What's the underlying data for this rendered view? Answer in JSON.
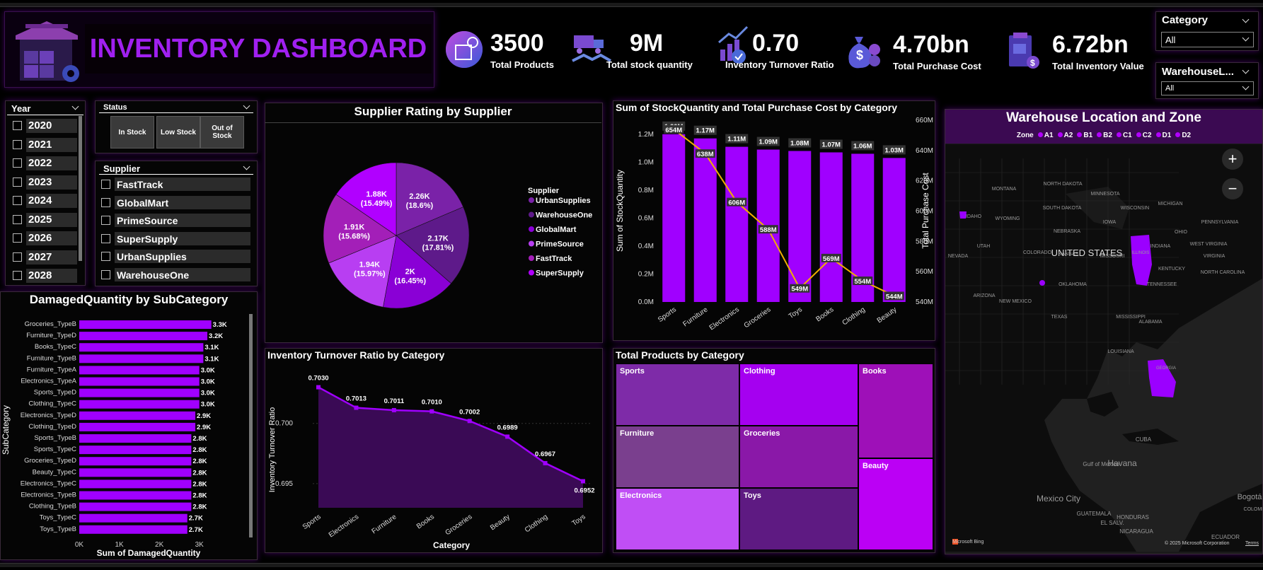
{
  "header": {
    "title": "INVENTORY DASHBOARD",
    "kpis": [
      {
        "value": "3500",
        "label": "Total Products"
      },
      {
        "value": "9M",
        "label": "Total stock quantity"
      },
      {
        "value": "0.70",
        "label": "Inventory Turnover Ratio"
      },
      {
        "value": "4.70bn",
        "label": "Total Purchase Cost"
      },
      {
        "value": "6.72bn",
        "label": "Total Inventory Value"
      }
    ]
  },
  "filters": {
    "category": {
      "label": "Category",
      "value": "All"
    },
    "warehouse": {
      "label": "WarehouseL...",
      "value": "All"
    },
    "year": {
      "label": "Year",
      "items": [
        "2020",
        "2021",
        "2022",
        "2023",
        "2024",
        "2025",
        "2026",
        "2027",
        "2028"
      ]
    },
    "status": {
      "label": "Status",
      "buttons": [
        "In Stock",
        "Low Stock",
        "Out of Stock"
      ]
    },
    "supplier": {
      "label": "Supplier",
      "items": [
        "FastTrack",
        "GlobalMart",
        "PrimeSource",
        "SuperSupply",
        "UrbanSupplies",
        "WarehouseOne"
      ]
    }
  },
  "colors": {
    "accent": "#9b00ff",
    "bar": "#a000ff",
    "line": "#f0b000",
    "panel_border": "#3a2a3a"
  },
  "charts": {
    "damaged": {
      "title": "DamagedQuantity by SubCategory",
      "xlabel": "Sum of DamagedQuantity",
      "ylabel": "SubCategory",
      "ticks": [
        "0K",
        "1K",
        "2K",
        "3K"
      ]
    },
    "pie": {
      "title": "Supplier Rating by Supplier",
      "legend_title": "Supplier"
    },
    "combo": {
      "title": "Sum of StockQuantity and Total Purchase Cost by Category",
      "ylabel_left": "Sum of StockQuantity",
      "ylabel_right": "Total Purchase Cost",
      "left_ticks": [
        "0.0M",
        "0.2M",
        "0.4M",
        "0.6M",
        "0.8M",
        "1.0M",
        "1.2M"
      ],
      "right_ticks": [
        "540M",
        "560M",
        "580M",
        "600M",
        "620M",
        "640M",
        "660M"
      ]
    },
    "turnover": {
      "title": "Inventory Turnover Ratio by Category",
      "xlabel": "Category",
      "ylabel": "Inventory Turnover Ratio",
      "yticks": [
        "0.695",
        "0.700"
      ]
    },
    "treemap": {
      "title": "Total Products by Category"
    },
    "map": {
      "title": "Warehouse Location and Zone",
      "legend_title": "Zone",
      "zones": [
        "A1",
        "A2",
        "B1",
        "B2",
        "C1",
        "C2",
        "D1",
        "D2"
      ],
      "labels": [
        "UNITED STATES",
        "Havana",
        "Mexico City",
        "CUBA",
        "GUATEMALA",
        "NICARAGUA",
        "HONDURAS",
        "EL SALV.",
        "Bogotá",
        "COLOMBIA",
        "ECUADOR",
        "MONTANA",
        "NORTH DAKOTA",
        "SOUTH DAKOTA",
        "WYOMING",
        "NEBRASKA",
        "COLORADO",
        "KANSAS",
        "OKLAHOMA",
        "TEXAS",
        "NEW MEXICO",
        "ARIZONA",
        "NEVADA",
        "UTAH",
        "IDAHO",
        "MISSOURI",
        "ILLINOIS",
        "INDIANA",
        "OHIO",
        "KENTUCKY",
        "TENNESSEE",
        "ALABAMA",
        "GEORGIA",
        "MINNESOTA",
        "WISCONSIN",
        "MICHIGAN",
        "IOWA",
        "MISSISSIPPI",
        "LOUISIANA",
        "VIRGINIA",
        "WEST VIRGINIA",
        "PENNSYLVANIA",
        "NORTH CAROLINA",
        "Gulf of Mexico"
      ],
      "attribution": "Microsoft Bing",
      "copyright": "© 2025 Microsoft Corporation",
      "terms": "Terms"
    }
  },
  "chart_data": [
    {
      "type": "bar",
      "orientation": "horizontal",
      "title": "DamagedQuantity by SubCategory",
      "xlabel": "Sum of DamagedQuantity",
      "ylabel": "SubCategory",
      "xlim": [
        0,
        3500
      ],
      "categories": [
        "Groceries_TypeB",
        "Furniture_TypeD",
        "Books_TypeC",
        "Furniture_TypeB",
        "Furniture_TypeA",
        "Electronics_TypeA",
        "Sports_TypeD",
        "Clothing_TypeC",
        "Electronics_TypeD",
        "Clothing_TypeD",
        "Sports_TypeB",
        "Sports_TypeC",
        "Groceries_TypeD",
        "Beauty_TypeC",
        "Electronics_TypeC",
        "Electronics_TypeB",
        "Clothing_TypeB",
        "Toys_TypeC",
        "Toys_TypeB"
      ],
      "values": [
        3300,
        3200,
        3100,
        3100,
        3000,
        3000,
        3000,
        3000,
        2900,
        2900,
        2800,
        2800,
        2800,
        2800,
        2800,
        2800,
        2800,
        2700,
        2700
      ],
      "labels": [
        "3.3K",
        "3.2K",
        "3.1K",
        "3.1K",
        "3.0K",
        "3.0K",
        "3.0K",
        "3.0K",
        "2.9K",
        "2.9K",
        "2.8K",
        "2.8K",
        "2.8K",
        "2.8K",
        "2.8K",
        "2.8K",
        "2.8K",
        "2.7K",
        "2.7K"
      ]
    },
    {
      "type": "pie",
      "title": "Supplier Rating by Supplier",
      "categories": [
        "UrbanSupplies",
        "WarehouseOne",
        "GlobalMart",
        "PrimeSource",
        "FastTrack",
        "SuperSupply"
      ],
      "values": [
        2260,
        2170,
        2000,
        1940,
        1910,
        1880
      ],
      "value_labels": [
        "2.26K",
        "2.17K",
        "2K",
        "1.94K",
        "1.91K",
        "1.88K"
      ],
      "percent_labels": [
        "(18.6%)",
        "(17.81%)",
        "(16.45%)",
        "(15.97%)",
        "(15.68%)",
        "(15.49%)"
      ],
      "colors": [
        "#7a22a8",
        "#5e1a8a",
        "#8a00d6",
        "#b83ef2",
        "#a31fb8",
        "#b100ff"
      ]
    },
    {
      "type": "bar",
      "combo": "bar+line",
      "title": "Sum of StockQuantity and Total Purchase Cost by Category",
      "categories": [
        "Sports",
        "Furniture",
        "Electronics",
        "Groceries",
        "Toys",
        "Books",
        "Clothing",
        "Beauty"
      ],
      "series": [
        {
          "name": "Sum of StockQuantity",
          "type": "bar",
          "values": [
            1200000,
            1170000,
            1110000,
            1090000,
            1080000,
            1070000,
            1060000,
            1030000
          ],
          "labels": [
            "1.20M",
            "1.17M",
            "1.11M",
            "1.09M",
            "1.08M",
            "1.07M",
            "1.06M",
            "1.03M"
          ]
        },
        {
          "name": "Total Purchase Cost",
          "type": "line",
          "values": [
            654000000,
            638000000,
            606000000,
            588000000,
            549000000,
            569000000,
            554000000,
            544000000
          ],
          "labels": [
            "654M",
            "638M",
            "606M",
            "588M",
            "549M",
            "569M",
            "554M",
            "544M"
          ]
        }
      ],
      "ylim_left": [
        0,
        1300000
      ],
      "ylim_right": [
        540000000,
        660000000
      ]
    },
    {
      "type": "area",
      "title": "Inventory Turnover Ratio by Category",
      "xlabel": "Category",
      "ylabel": "Inventory Turnover Ratio",
      "categories": [
        "Sports",
        "Electronics",
        "Furniture",
        "Books",
        "Groceries",
        "Beauty",
        "Clothing",
        "Toys"
      ],
      "values": [
        0.703,
        0.7013,
        0.7011,
        0.701,
        0.7002,
        0.6989,
        0.6967,
        0.6952
      ],
      "labels": [
        "0.7030",
        "0.7013",
        "0.7011",
        "0.7010",
        "0.7002",
        "0.6989",
        "0.6967",
        "0.6952"
      ],
      "ylim": [
        0.693,
        0.7045
      ]
    },
    {
      "type": "treemap",
      "title": "Total Products by Category",
      "categories": [
        "Sports",
        "Clothing",
        "Books",
        "Furniture",
        "Groceries",
        "Beauty",
        "Electronics",
        "Toys"
      ],
      "colors": [
        "#7e2ba8",
        "#a500f0",
        "#9e10b8",
        "#7a3f8e",
        "#8a18a8",
        "#bb00f5",
        "#c04ef5",
        "#5e1a82"
      ]
    }
  ]
}
